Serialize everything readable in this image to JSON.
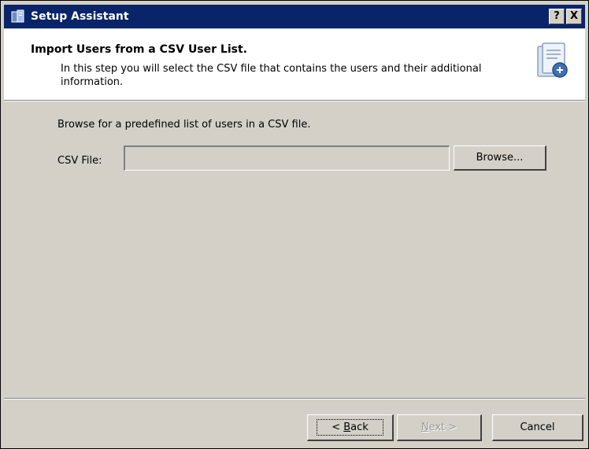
{
  "window": {
    "title": "Setup Assistant",
    "help_label": "?",
    "close_label": "X"
  },
  "header": {
    "title": "Import Users from a CSV User List.",
    "description": "In this step you will select the CSV file that contains the users and their additional information.",
    "icon": "setup-document-icon"
  },
  "main": {
    "instruction": "Browse for a predefined list of users in a CSV file.",
    "csv_label": "CSV File:",
    "csv_value": "",
    "browse_label": "Browse..."
  },
  "footer": {
    "back_prefix": "< ",
    "back_access_key": "B",
    "back_rest": "ack",
    "next_access_key": "N",
    "next_rest": "ext >",
    "cancel_label": "Cancel"
  },
  "colors": {
    "titlebar": "#0a246a",
    "dialog_face": "#d4d0c8",
    "header_bg": "#ffffff"
  }
}
